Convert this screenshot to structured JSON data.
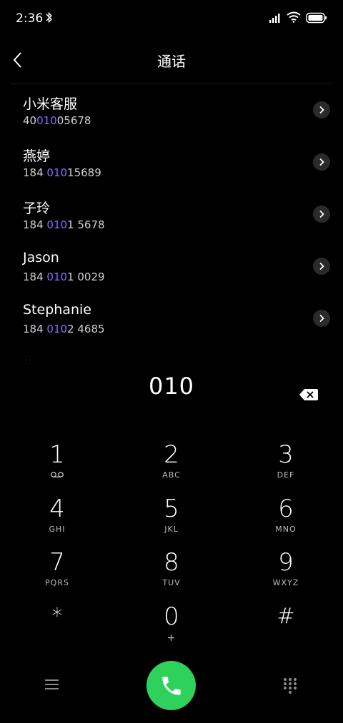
{
  "status": {
    "time": "2:36"
  },
  "header": {
    "title": "通话"
  },
  "contacts": [
    {
      "name": "小米客服",
      "num_pre": "40",
      "num_match": "010",
      "num_post": "05678"
    },
    {
      "name": "燕婷",
      "num_pre": "184 ",
      "num_match": "010",
      "num_post": "15689"
    },
    {
      "name": "子玲",
      "num_pre": "184 ",
      "num_match": "010",
      "num_post": "1 5678"
    },
    {
      "name": "Jason",
      "num_pre": "184 ",
      "num_match": "010",
      "num_post": "1 0029"
    },
    {
      "name": "Stephanie",
      "num_pre": "184 ",
      "num_match": "010",
      "num_post": "2 4685"
    }
  ],
  "dial": {
    "entered": "010"
  },
  "keypad": [
    {
      "digit": "1",
      "letters": ""
    },
    {
      "digit": "2",
      "letters": "ABC"
    },
    {
      "digit": "3",
      "letters": "DEF"
    },
    {
      "digit": "4",
      "letters": "GHI"
    },
    {
      "digit": "5",
      "letters": "JKL"
    },
    {
      "digit": "6",
      "letters": "MNO"
    },
    {
      "digit": "7",
      "letters": "PQRS"
    },
    {
      "digit": "8",
      "letters": "TUV"
    },
    {
      "digit": "9",
      "letters": "WXYZ"
    },
    {
      "digit": "*",
      "letters": ""
    },
    {
      "digit": "0",
      "letters": "+"
    },
    {
      "digit": "#",
      "letters": ""
    }
  ],
  "colors": {
    "highlight": "#8b6bff",
    "call": "#2ed15a",
    "background": "#000000"
  },
  "icons": [
    "bluetooth-icon",
    "signal-icon",
    "wifi-icon",
    "battery-icon",
    "back-icon",
    "chevron-right-icon",
    "backspace-icon",
    "voicemail-icon",
    "menu-icon",
    "phone-icon",
    "dialpad-icon"
  ]
}
